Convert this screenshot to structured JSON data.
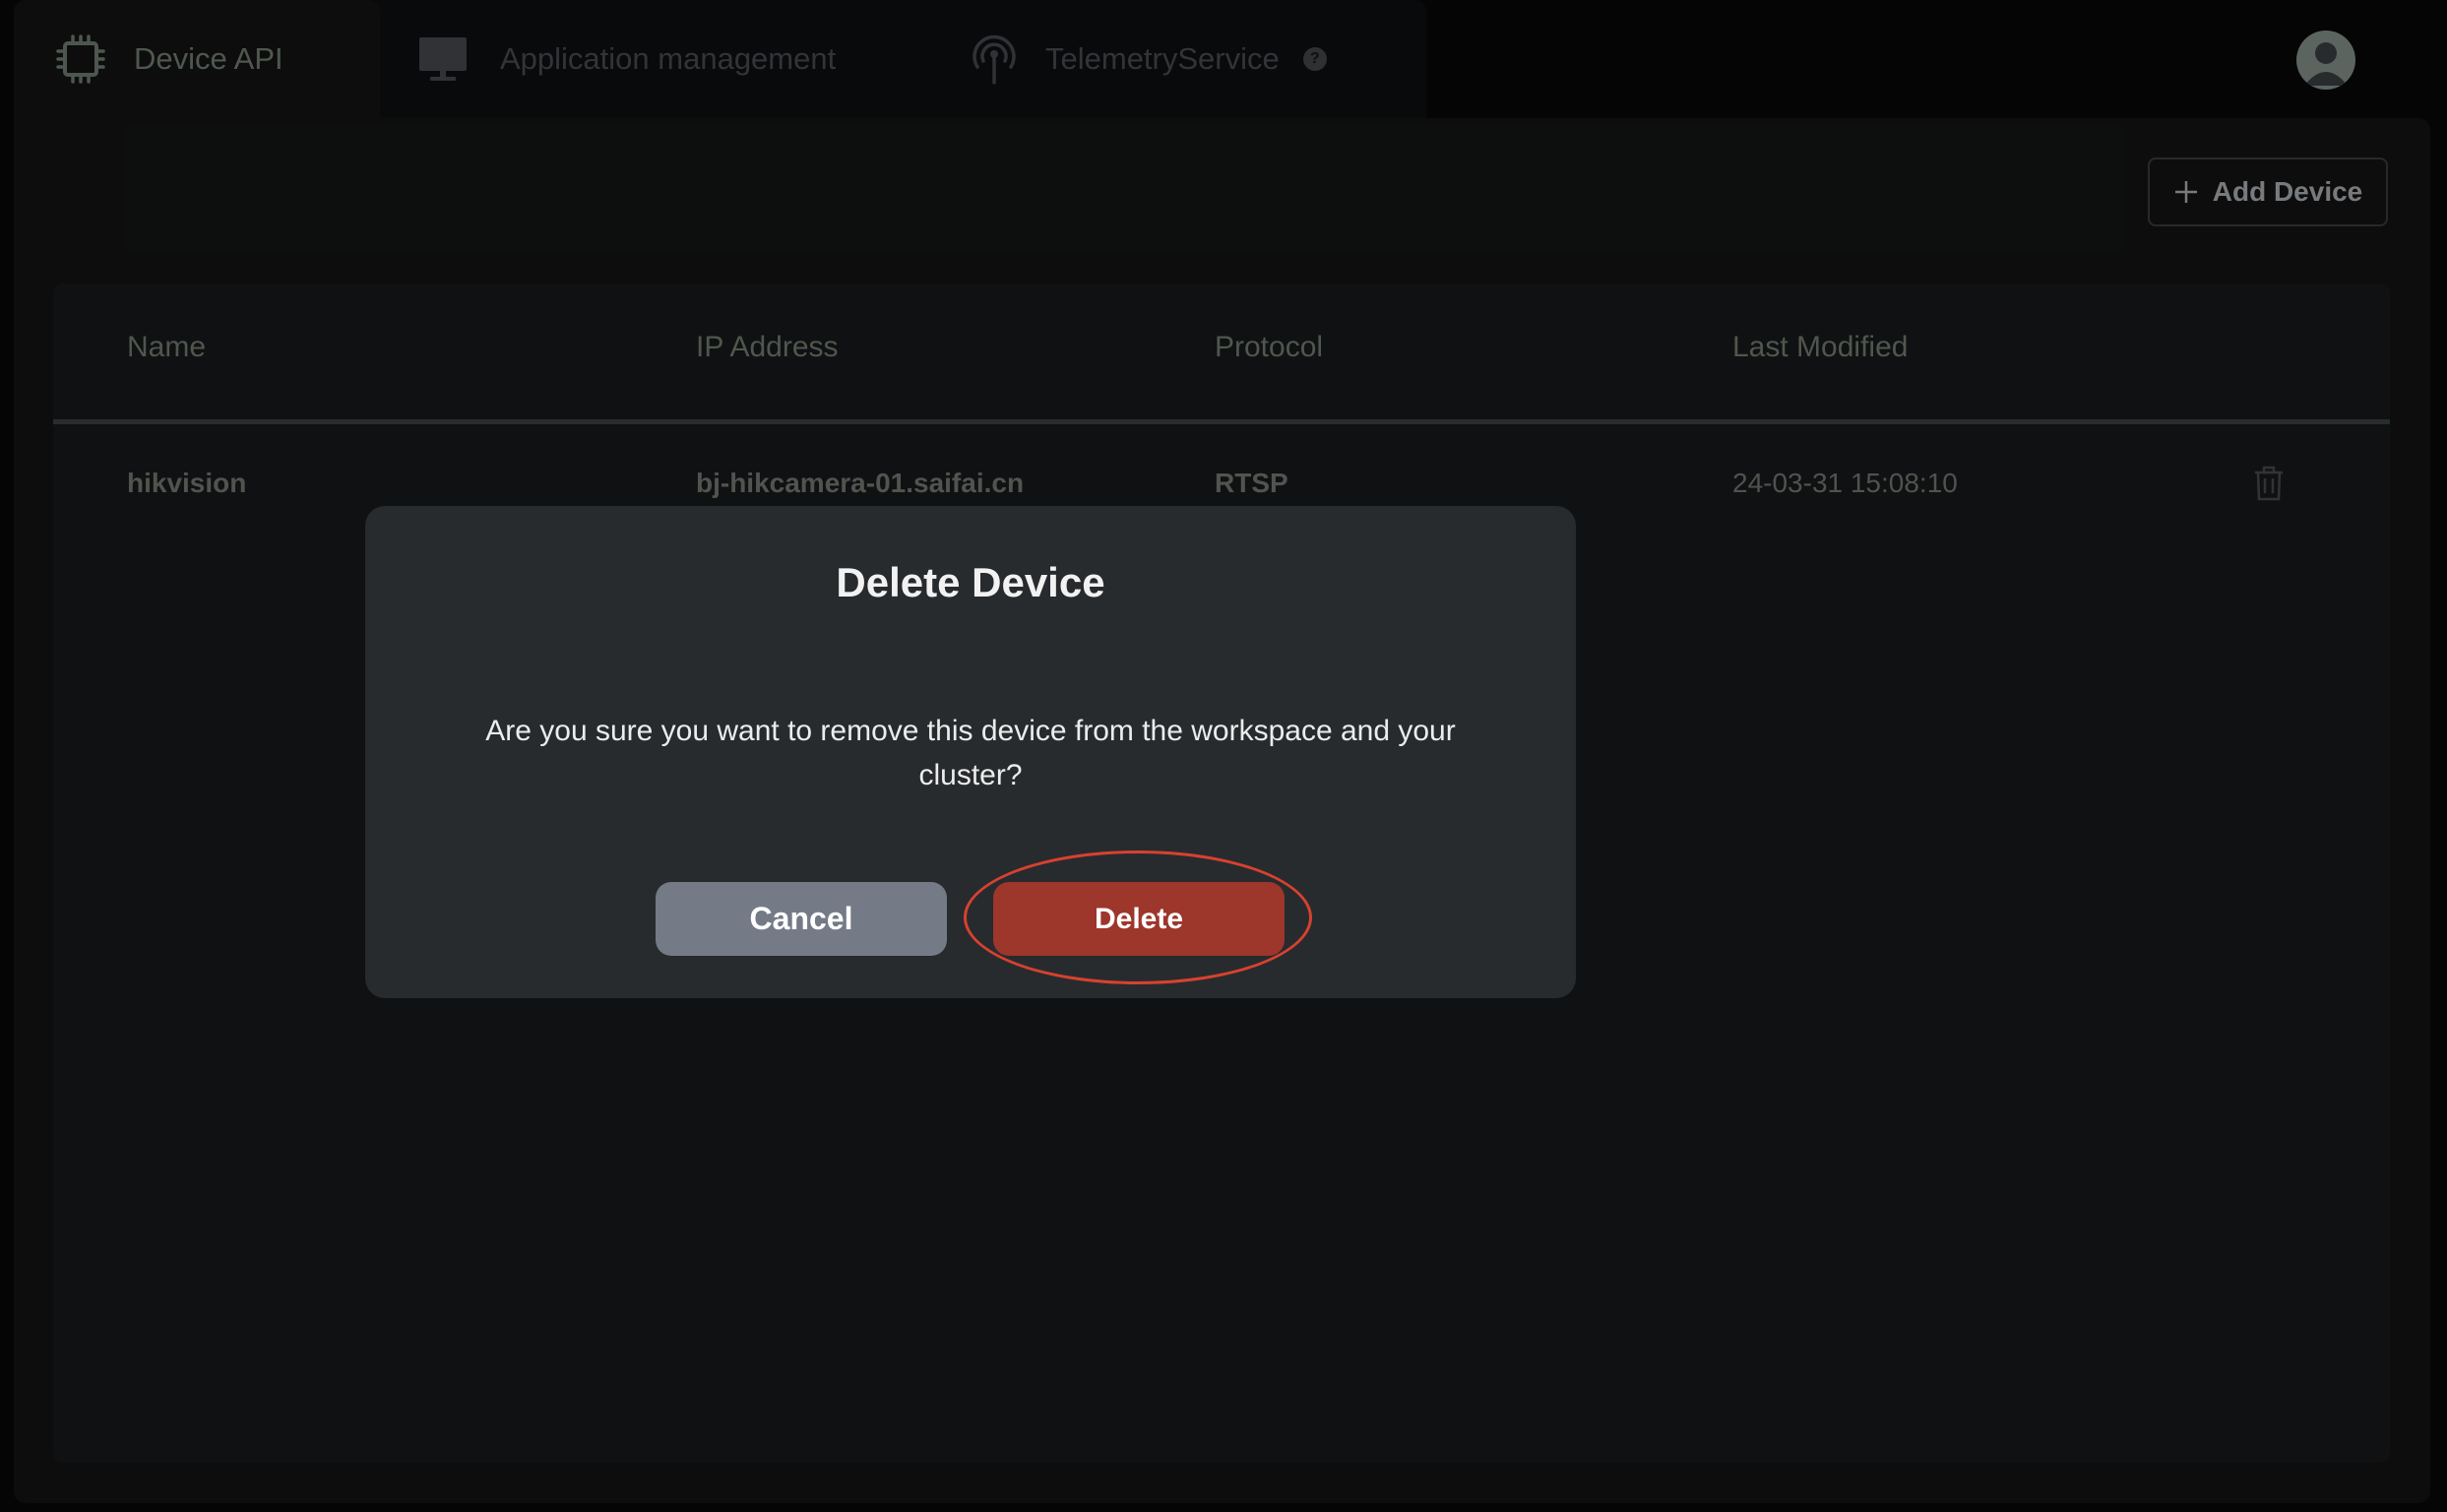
{
  "tabs": [
    {
      "label": "Device API",
      "icon": "chip-icon",
      "active": true
    },
    {
      "label": "Application management",
      "icon": "monitor-icon",
      "active": false
    },
    {
      "label": "TelemetryService",
      "icon": "broadcast-icon",
      "active": false,
      "help": "?"
    }
  ],
  "header": {
    "avatar_icon": "user-avatar-icon"
  },
  "toolbar": {
    "add_device_label": "Add Device"
  },
  "table": {
    "columns": [
      "Name",
      "IP Address",
      "Protocol",
      "Last Modified"
    ],
    "rows": [
      {
        "name": "hikvision",
        "ip_address": "bj-hikcamera-01.saifai.cn",
        "protocol": "RTSP",
        "last_modified": "24-03-31 15:08:10"
      }
    ]
  },
  "dialog": {
    "title": "Delete Device",
    "message": "Are you sure you want to remove this device from the workspace and your cluster?",
    "cancel_label": "Cancel",
    "delete_label": "Delete"
  },
  "colors": {
    "danger": "#9d362b",
    "highlight_ring": "#d8412f",
    "cancel": "#747b87",
    "dialog_bg": "#272b2e"
  }
}
